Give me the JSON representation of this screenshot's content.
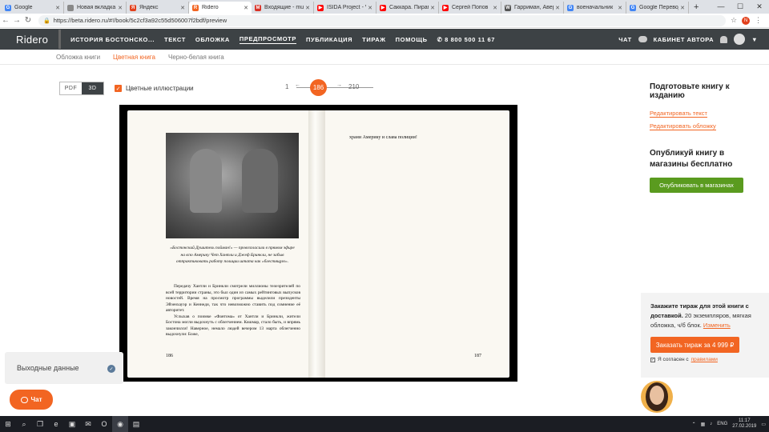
{
  "browser": {
    "tabs": [
      {
        "label": "Google",
        "color": "#4285f4",
        "glyph": "G"
      },
      {
        "label": "Новая вкладка",
        "color": "#888888",
        "glyph": ""
      },
      {
        "label": "Яндекс",
        "color": "#e2401c",
        "glyph": "Я"
      },
      {
        "label": "Ridero",
        "color": "#f26522",
        "glyph": "R",
        "active": true
      },
      {
        "label": "Входящие - mu",
        "color": "#d93025",
        "glyph": "M"
      },
      {
        "label": "ISIDA Project - V",
        "color": "#ff0000",
        "glyph": "▶"
      },
      {
        "label": "Саккара. Пирам",
        "color": "#ff0000",
        "glyph": "▶"
      },
      {
        "label": "Сергей Попов",
        "color": "#ff0000",
        "glyph": "▶"
      },
      {
        "label": "Гарриман, Авер",
        "color": "#555555",
        "glyph": "W"
      },
      {
        "label": "военачальник",
        "color": "#4285f4",
        "glyph": "G"
      },
      {
        "label": "Google Перевод",
        "color": "#4285f4",
        "glyph": "G"
      }
    ],
    "url": "https://beta.ridero.ru/#!/book/5c2cf3a92c55d506007f2bdf/preview",
    "profile_initial": "N"
  },
  "header": {
    "logo": "Ridero",
    "menu": [
      {
        "label": "ИСТОРИЯ БОСТОНСКО...",
        "active": false
      },
      {
        "label": "ТЕКСТ",
        "active": false
      },
      {
        "label": "ОБЛОЖКА",
        "active": false
      },
      {
        "label": "ПРЕДПРОСМОТР",
        "active": true
      },
      {
        "label": "ПУБЛИКАЦИЯ",
        "active": false
      },
      {
        "label": "ТИРАЖ",
        "active": false
      },
      {
        "label": "ПОМОЩЬ",
        "active": false
      },
      {
        "label": "✆ 8 800 500 11 67",
        "active": false
      }
    ],
    "chat": "ЧАТ",
    "cabinet": "КАБИНЕТ АВТОРА"
  },
  "subnav": [
    {
      "label": "Обложка книги",
      "active": false
    },
    {
      "label": "Цветная книга",
      "active": true
    },
    {
      "label": "Черно-белая книга",
      "active": false
    }
  ],
  "viewer": {
    "format_pdf": "PDF",
    "format_3d": "3D",
    "color_illustrations": "Цветные иллюстрации",
    "page_first": "1",
    "page_current": "186",
    "page_last": "210"
  },
  "book": {
    "caption": "«Бостонский Душитель пойман!» — провозгласили в прямом эфире на всю Америку Чет Хантли и Джеф Бринкли, не забыв отпрактиковать работу полиции штата как «блестящую».",
    "para1": "Передачу Хантли и Бринкли смотрели миллионы телезрителей по всей территории страны, это был один из самых рейтинговых выпусков новостей. Время на просмотр программы выделили президенты Эйзенхауэр и Кеннеди, так что невозможно ставить под сомнение её авторитет.",
    "para2": "Услыхав о поимке «Фантома» от Хантли и Бринкли, жители Бостона могли выдохнуть с облегчением. Кошмар, стало быть, и впрямь закончился! Наверное, немало людей вечером 13 марта облегченно выдохнули: Боже,",
    "left_page_num": "186",
    "right_text": "храни Америку и слава полиции!",
    "right_page_num": "187"
  },
  "sidebar": {
    "prepare_title": "Подготовьте книгу к изданию",
    "edit_text": "Редактировать текст",
    "edit_cover": "Редактировать обложку",
    "publish_title": "Опубликуй книгу в магазины бесплатно",
    "publish_btn": "Опубликовать в магазинах",
    "print_bold": "Закажите тираж для этой книги с доставкой.",
    "print_text": " 20 экземпляров, мягкая обложка, ч/б блок. ",
    "print_change": "Изменить",
    "print_btn": "Заказать тираж за 4 999 ₽",
    "agree_prefix": "Я согласен с ",
    "agree_link": "правилами"
  },
  "bottom_left": {
    "output_data": "Выходные данные",
    "chat": "Чат"
  },
  "taskbar": {
    "lang": "ENG",
    "time": "11:17",
    "date": "27.02.2019"
  },
  "colors": {
    "accent": "#f26522",
    "header_bg": "#3d4245",
    "publish_green": "#5a9b1f"
  }
}
